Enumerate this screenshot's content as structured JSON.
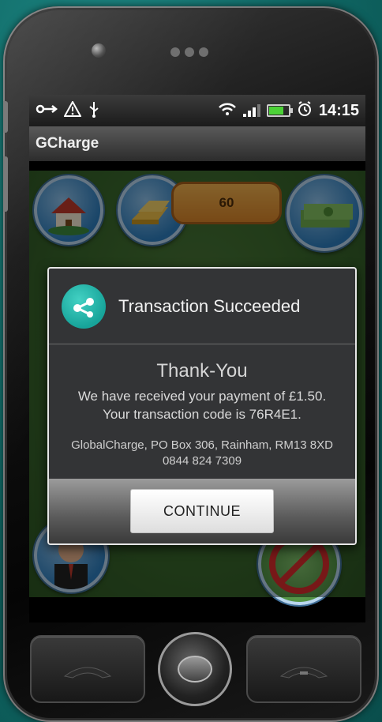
{
  "status_bar": {
    "left_icons": [
      "usb-link-icon",
      "warning-icon",
      "usb-icon"
    ],
    "right_icons": [
      "wifi-icon",
      "signal-icon",
      "battery-icon",
      "alarm-icon"
    ],
    "time": "14:15"
  },
  "app": {
    "title": "GCharge"
  },
  "game_background": {
    "coin_count": "60"
  },
  "dialog": {
    "title": "Transaction Succeeded",
    "thanks": "Thank-You",
    "message_line1": "We have received your payment of £1.50.",
    "message_line2": "Your transaction code is 76R4E1.",
    "address_line1": "GlobalCharge, PO Box 306, Rainham, RM13 8XD",
    "address_line2": "0844 824 7309",
    "continue_label": "CONTINUE"
  },
  "colors": {
    "background": "#0f6764",
    "dialog_bg": "#333436",
    "logo": "#17a49a"
  }
}
